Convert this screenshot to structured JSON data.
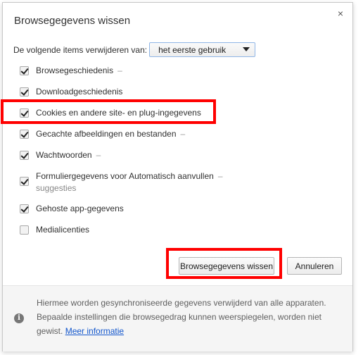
{
  "dialog": {
    "title": "Browsegegevens wissen",
    "close_label": "×"
  },
  "from": {
    "label": "De volgende items verwijderen van:",
    "selected": "het eerste gebruik"
  },
  "items": [
    {
      "label": "Browsegeschiedenis",
      "detail": "–",
      "checked": true
    },
    {
      "label": "Downloadgeschiedenis",
      "detail": "",
      "checked": true
    },
    {
      "label": "Cookies en andere site- en plug-ingegevens",
      "detail": "",
      "checked": true
    },
    {
      "label": "Gecachte afbeeldingen en bestanden",
      "detail": "–",
      "checked": true
    },
    {
      "label": "Wachtwoorden",
      "detail": "–",
      "checked": true
    },
    {
      "label": "Formuliergegevens voor Automatisch aanvullen",
      "detail": "–",
      "sub": "suggesties",
      "checked": true
    },
    {
      "label": "Gehoste app-gegevens",
      "detail": "",
      "checked": true
    },
    {
      "label": "Medialicenties",
      "detail": "",
      "checked": false
    }
  ],
  "buttons": {
    "clear": "Browsegegevens wissen",
    "cancel": "Annuleren"
  },
  "footer": {
    "text": "Hiermee worden gesynchroniseerde gegevens verwijderd van alle apparaten. Bepaalde instellingen die browsegedrag kunnen weerspiegelen, worden niet gewist.",
    "link": "Meer informatie"
  },
  "colors": {
    "highlight": "#ff0000",
    "link": "#1155cc"
  }
}
